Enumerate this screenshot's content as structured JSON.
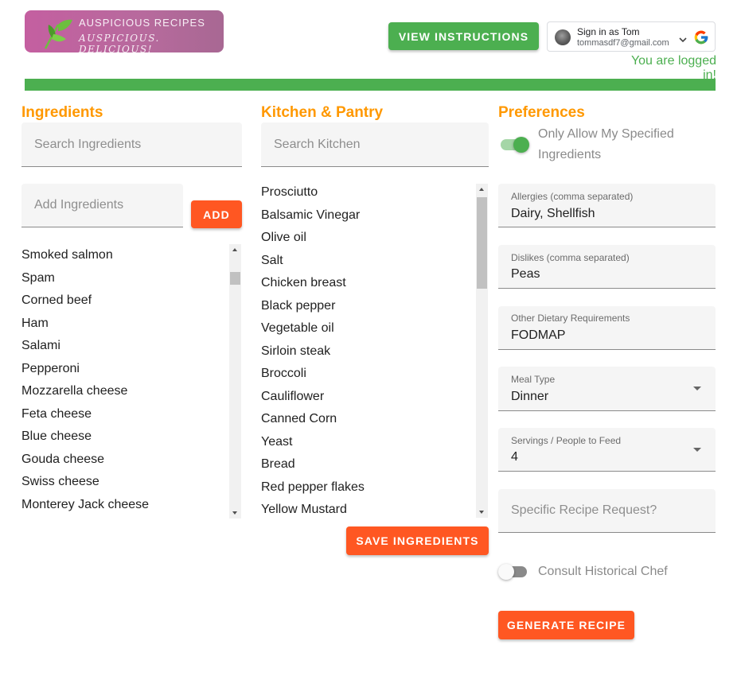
{
  "header": {
    "logo_title": "AUSPICIOUS RECIPES",
    "logo_tagline": "AUSPICIOUS. DELICIOUS!",
    "view_instructions_label": "VIEW INSTRUCTIONS",
    "account": {
      "signed_in_as": "Sign in as Tom",
      "email": "tommasdf7@gmail.com"
    },
    "logged_in_text": "You are logged in!"
  },
  "ingredients": {
    "title": "Ingredients",
    "search_placeholder": "Search Ingredients",
    "add_placeholder": "Add Ingredients",
    "add_label": "ADD",
    "items": [
      "Smoked salmon",
      "Spam",
      "Corned beef",
      "Ham",
      "Salami",
      "Pepperoni",
      "Mozzarella cheese",
      "Feta cheese",
      "Blue cheese",
      "Gouda cheese",
      "Swiss cheese",
      "Monterey Jack cheese"
    ]
  },
  "kitchen": {
    "title": "Kitchen & Pantry",
    "search_placeholder": "Search Kitchen",
    "items": [
      "Prosciutto",
      "Balsamic Vinegar",
      "Olive oil",
      "Salt",
      "Chicken breast",
      "Black pepper",
      "Vegetable oil",
      "Sirloin steak",
      "Broccoli",
      "Cauliflower",
      "Canned Corn",
      "Yeast",
      "Bread",
      "Red pepper flakes",
      "Yellow Mustard"
    ],
    "save_label": "SAVE INGREDIENTS"
  },
  "preferences": {
    "title": "Preferences",
    "only_allow_label": "Only Allow My Specified Ingredients",
    "only_allow_on": true,
    "allergies": {
      "label": "Allergies (comma separated)",
      "value": "Dairy, Shellfish"
    },
    "dislikes": {
      "label": "Dislikes (comma separated)",
      "value": "Peas"
    },
    "dietary": {
      "label": "Other Dietary Requirements",
      "value": "FODMAP"
    },
    "meal_type": {
      "label": "Meal Type",
      "value": "Dinner"
    },
    "servings": {
      "label": "Servings / People to Feed",
      "value": "4"
    },
    "specific_request_placeholder": "Specific Recipe Request?",
    "historical_chef_label": "Consult Historical Chef",
    "historical_chef_on": false,
    "generate_label": "GENERATE RECIPE"
  },
  "colors": {
    "accent_orange": "#ff5722",
    "title_orange": "#ff9800",
    "green": "#4caf50",
    "logo_pink": "#c45fa0"
  },
  "icons": {
    "logo": "leaves-icon",
    "google": "google-g-icon",
    "chevron": "chevron-down-icon",
    "dropdown": "arrow-drop-down-icon"
  }
}
